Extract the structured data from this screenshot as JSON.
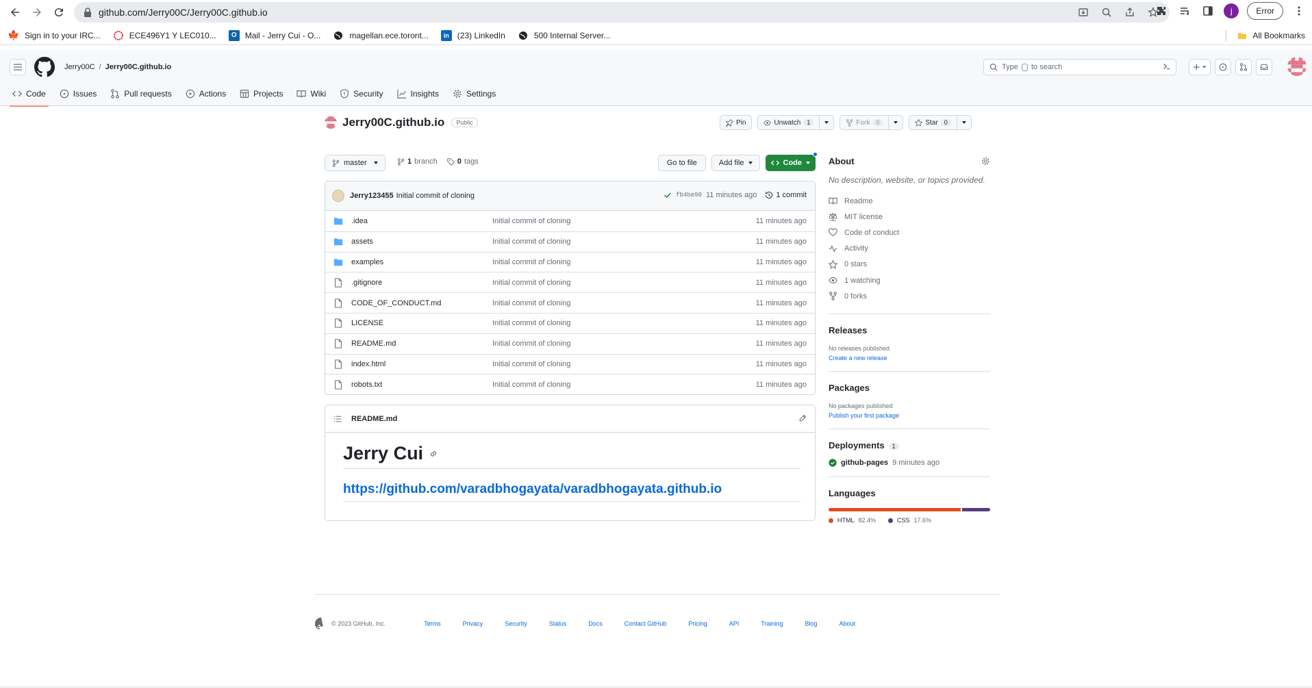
{
  "browser": {
    "url": "github.com/Jerry00C/Jerry00C.github.io",
    "profile_initial": "j",
    "error_label": "Error"
  },
  "bookmarks": [
    {
      "label": "Sign in to your IRC...",
      "icon": "maple-leaf-icon",
      "color": "#d52b1e"
    },
    {
      "label": "ECE496Y1 Y LEC010...",
      "icon": "quercus-icon",
      "color": "#e31837"
    },
    {
      "label": "Mail - Jerry Cui - O...",
      "icon": "outlook-icon",
      "color": "#0a64ad"
    },
    {
      "label": "magellan.ece.toront...",
      "icon": "globe-icon",
      "color": "#202124"
    },
    {
      "label": "(23) LinkedIn",
      "icon": "linkedin-icon",
      "color": "#0a66c2"
    },
    {
      "label": "500 Internal Server...",
      "icon": "globe-icon",
      "color": "#202124"
    }
  ],
  "all_bookmarks": "All Bookmarks",
  "github": {
    "owner": "Jerry00C",
    "repo": "Jerry00C.github.io",
    "search_placeholder_pre": "Type",
    "search_placeholder_post": "to search",
    "tabs": [
      {
        "label": "Code",
        "icon": "code-icon",
        "active": true
      },
      {
        "label": "Issues",
        "icon": "issue-icon"
      },
      {
        "label": "Pull requests",
        "icon": "pull-request-icon"
      },
      {
        "label": "Actions",
        "icon": "play-icon"
      },
      {
        "label": "Projects",
        "icon": "table-icon"
      },
      {
        "label": "Wiki",
        "icon": "book-icon"
      },
      {
        "label": "Security",
        "icon": "shield-icon"
      },
      {
        "label": "Insights",
        "icon": "graph-icon"
      },
      {
        "label": "Settings",
        "icon": "gear-icon"
      }
    ]
  },
  "repo": {
    "name": "Jerry00C.github.io",
    "visibility": "Public",
    "pin": "Pin",
    "unwatch": "Unwatch",
    "watch_count": "1",
    "fork": "Fork",
    "fork_count": "0",
    "star": "Star",
    "star_count": "0"
  },
  "branch": {
    "name": "master",
    "branch_count": "1",
    "branch_label": "branch",
    "tag_count": "0",
    "tag_label": "tags",
    "go_to_file": "Go to file",
    "add_file": "Add file",
    "code": "Code"
  },
  "commit": {
    "author": "Jerry123455",
    "message": "Initial commit of cloning",
    "sha": "fb4be98",
    "time": "11 minutes ago",
    "count_label": "1 commit"
  },
  "files": [
    {
      "name": ".idea",
      "type": "folder",
      "message": "Initial commit of cloning",
      "time": "11 minutes ago"
    },
    {
      "name": "assets",
      "type": "folder",
      "message": "Initial commit of cloning",
      "time": "11 minutes ago"
    },
    {
      "name": "examples",
      "type": "folder",
      "message": "Initial commit of cloning",
      "time": "11 minutes ago"
    },
    {
      "name": ".gitignore",
      "type": "file",
      "message": "Initial commit of cloning",
      "time": "11 minutes ago"
    },
    {
      "name": "CODE_OF_CONDUCT.md",
      "type": "file",
      "message": "Initial commit of cloning",
      "time": "11 minutes ago"
    },
    {
      "name": "LICENSE",
      "type": "file",
      "message": "Initial commit of cloning",
      "time": "11 minutes ago"
    },
    {
      "name": "README.md",
      "type": "file",
      "message": "Initial commit of cloning",
      "time": "11 minutes ago"
    },
    {
      "name": "index.html",
      "type": "file",
      "message": "Initial commit of cloning",
      "time": "11 minutes ago"
    },
    {
      "name": "robots.txt",
      "type": "file",
      "message": "Initial commit of cloning",
      "time": "11 minutes ago"
    }
  ],
  "readme": {
    "filename": "README.md",
    "heading": "Jerry Cui",
    "link": "https://github.com/varadbhogayata/varadbhogayata.github.io"
  },
  "about": {
    "title": "About",
    "description": "No description, website, or topics provided.",
    "items": [
      {
        "label": "Readme",
        "icon": "book-icon"
      },
      {
        "label": "MIT license",
        "icon": "law-icon"
      },
      {
        "label": "Code of conduct",
        "icon": "heart-icon"
      },
      {
        "label": "Activity",
        "icon": "pulse-icon"
      },
      {
        "label": "0 stars",
        "icon": "star-icon"
      },
      {
        "label": "1 watching",
        "icon": "eye-icon"
      },
      {
        "label": "0 forks",
        "icon": "fork-icon"
      }
    ]
  },
  "releases": {
    "title": "Releases",
    "none": "No releases published",
    "link": "Create a new release"
  },
  "packages": {
    "title": "Packages",
    "none": "No packages published",
    "link": "Publish your first package"
  },
  "deployments": {
    "title": "Deployments",
    "count": "1",
    "name": "github-pages",
    "time": "9 minutes ago"
  },
  "languages": {
    "title": "Languages",
    "items": [
      {
        "name": "HTML",
        "percent": "82.4%",
        "value": 82.4,
        "color": "#e34c26"
      },
      {
        "name": "CSS",
        "percent": "17.6%",
        "value": 17.6,
        "color": "#563d7c"
      }
    ]
  },
  "footer": {
    "copyright": "© 2023 GitHub, Inc.",
    "links": [
      "Terms",
      "Privacy",
      "Security",
      "Status",
      "Docs",
      "Contact GitHub",
      "Pricing",
      "API",
      "Training",
      "Blog",
      "About"
    ]
  }
}
